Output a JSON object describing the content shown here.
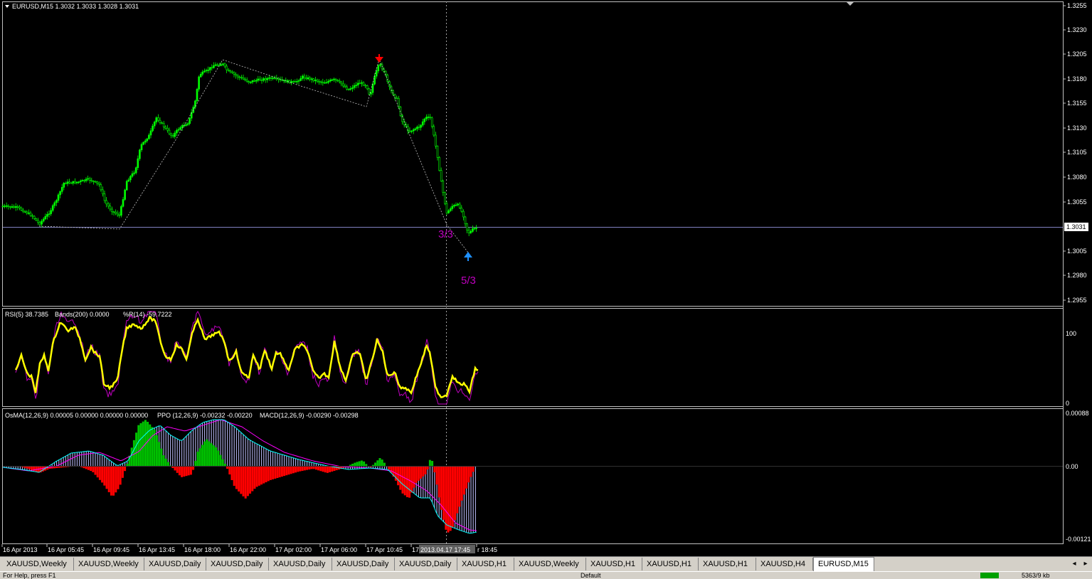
{
  "main_chart": {
    "header": "EURUSD,M15  1.3032 1.3033 1.3028 1.3031",
    "price_labels": [
      "1.3255",
      "1.3230",
      "1.3205",
      "1.3180",
      "1.3155",
      "1.3130",
      "1.3105",
      "1.3080",
      "1.3055",
      "1.3031",
      "1.3005",
      "1.2980",
      "1.2955"
    ],
    "current_price": "1.3031",
    "annotation_33": "3/3",
    "annotation_53": "5/3",
    "colors": {
      "bull": "#00ff00",
      "bear": "#00ff00",
      "zigzag": "#c0c0c0",
      "price_line": "#8080c0",
      "marker_down": "#ff0000",
      "marker_up": "#1e90ff",
      "annotation": "#c000c0"
    }
  },
  "rsi_panel": {
    "header_rsi": "RSI(5) 38.7385",
    "header_bands": "Bands(200) 0.0000",
    "header_wpr": "%R(14) -59.7222",
    "scale_top": "100",
    "scale_bottom": "0",
    "colors": {
      "rsi": "#ffff00",
      "wpr": "#c000c0"
    }
  },
  "macd_panel": {
    "header_osma": "OsMA(12,26,9) 0.00005 0.00000 0.00000 0.00000",
    "header_ppo": "PPO (12,26,9) -0.00232 -0.00220",
    "header_macd": "MACD(12,26,9) -0.00290 -0.00298",
    "scale_top": "0.00088",
    "scale_mid": "0.00",
    "scale_bottom": "-0.00121",
    "colors": {
      "pos": "#00c000",
      "neg": "#ff0000",
      "macd_hist": "#c0c0ff",
      "signal": "#ff00ff",
      "ppo": "#00ffff"
    }
  },
  "time_axis": [
    "16 Apr 2013",
    "16 Apr 05:45",
    "16 Apr 09:45",
    "16 Apr 13:45",
    "16 Apr 18:00",
    "16 Apr 22:00",
    "17 Apr 02:00",
    "17 Apr 06:00",
    "17 Apr 10:45",
    "17",
    "r 18:45"
  ],
  "crosshair_time": "2013.04.17 17:45",
  "tabs": [
    "XAUUSD,Weekly",
    "XAUUSD,Weekly",
    "XAUUSD,Daily",
    "XAUUSD,Daily",
    "XAUUSD,Daily",
    "XAUUSD,Daily",
    "XAUUSD,Daily",
    "XAUUSD,H1",
    "XAUUSD,Weekly",
    "XAUUSD,H1",
    "XAUUSD,H1",
    "XAUUSD,H1",
    "XAUUSD,H4",
    "EURUSD,M15"
  ],
  "active_tab": 13,
  "status": {
    "left": "For Help, press F1",
    "middle": "Default",
    "right": "5363/9 kb"
  }
}
